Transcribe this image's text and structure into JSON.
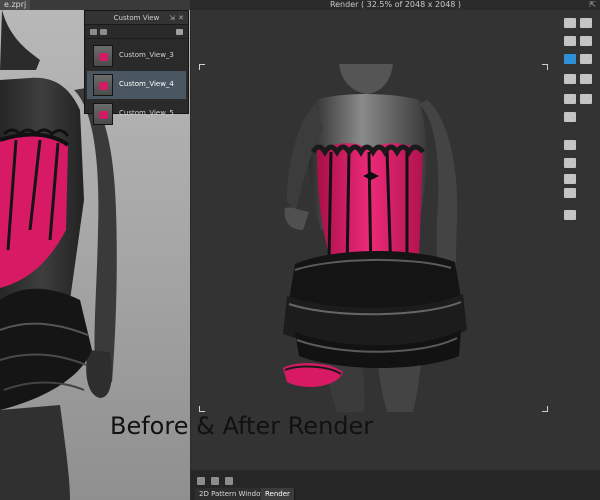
{
  "left_panel": {
    "file_tab": "e.zprj"
  },
  "custom_view": {
    "title": "Custom View",
    "items": [
      {
        "label": "Custom_View_3"
      },
      {
        "label": "Custom_View_4"
      },
      {
        "label": "Custom_View_5"
      }
    ],
    "selected_index": 1
  },
  "render": {
    "title": "Render ( 32.5% of 2048 x 2048 )"
  },
  "caption": "Before & After Render",
  "tabs": [
    {
      "label": "2D Pattern Window"
    },
    {
      "label": "Render"
    }
  ],
  "colors": {
    "garment_pink": "#d81a64",
    "garment_black": "#141414",
    "selection": "#4a5763",
    "toolbar_accent": "#2f8fd8"
  },
  "icons": [
    "pin-icon",
    "close-icon",
    "add-view-icon",
    "delete-view-icon",
    "camera-icon",
    "render-start-icon",
    "render-stop-icon",
    "camera-view-icon",
    "light-icon",
    "image-save-icon",
    "settings-icon"
  ]
}
